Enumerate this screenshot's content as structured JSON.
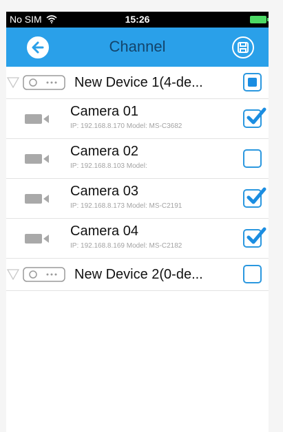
{
  "statusbar": {
    "carrier": "No SIM",
    "time": "15:26"
  },
  "navbar": {
    "title": "Channel",
    "back_icon": "arrow-left-circle-icon",
    "save_icon": "save-circle-icon"
  },
  "devices": [
    {
      "label": "New Device 1(4-de...",
      "checked": "partial",
      "expanded": true,
      "cameras": [
        {
          "name": "Camera 01",
          "info": "IP: 192.168.8.170 Model: MS-C3682",
          "checked": true
        },
        {
          "name": "Camera 02",
          "info": "IP: 192.168.8.103 Model:",
          "checked": false
        },
        {
          "name": "Camera 03",
          "info": "IP: 192.168.8.173 Model: MS-C2191",
          "checked": true
        },
        {
          "name": "Camera 04",
          "info": "IP: 192.168.8.169 Model: MS-C2182",
          "checked": true
        }
      ]
    },
    {
      "label": "New Device 2(0-de...",
      "checked": "none",
      "expanded": false,
      "cameras": []
    }
  ],
  "colors": {
    "accent": "#2aa0e9",
    "title_text": "#13446b",
    "checkbox_border": "#2a97df",
    "battery": "#4cd964"
  }
}
